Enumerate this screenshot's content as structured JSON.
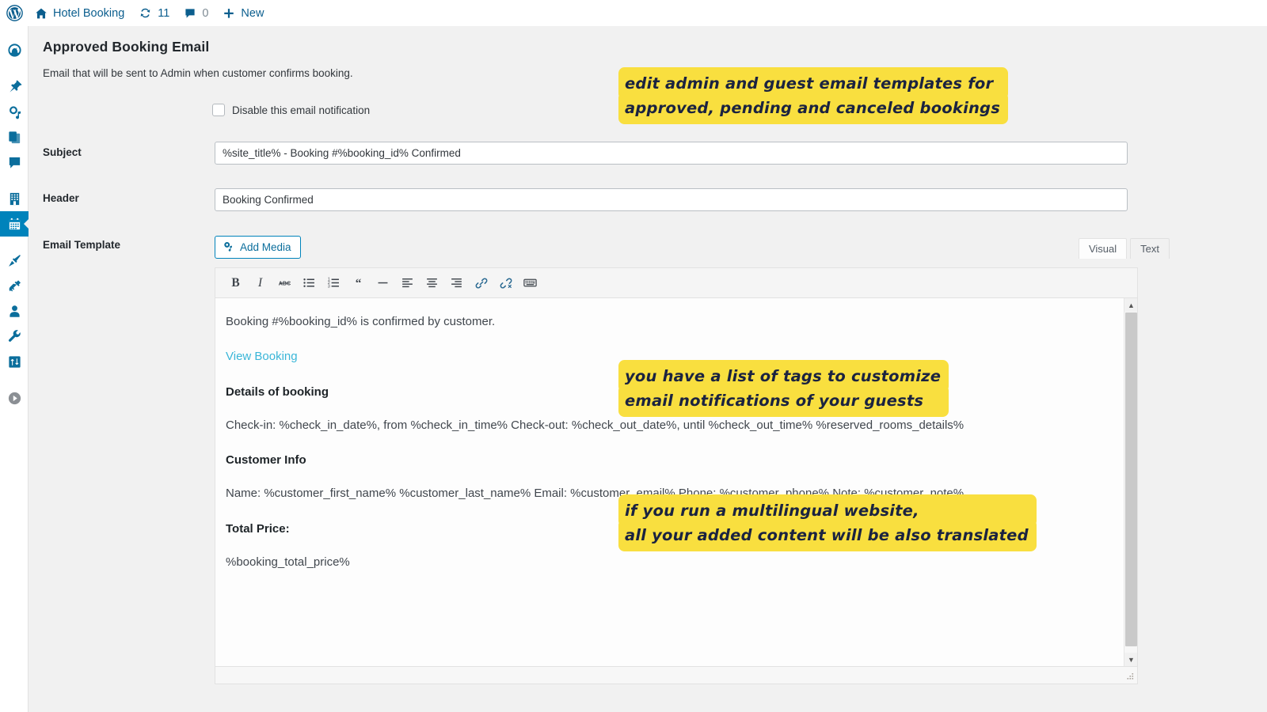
{
  "adminbar": {
    "wp_logo": "wordpress-logo",
    "site_name": "Hotel Booking",
    "updates_count": "11",
    "comments_count": "0",
    "new_label": "New"
  },
  "sidebar": {
    "items": [
      {
        "name": "dashboard",
        "icon": "dashboard-icon",
        "active": false
      },
      {
        "name": "posts",
        "icon": "pin-icon",
        "active": false
      },
      {
        "name": "media",
        "icon": "media-icon",
        "active": false
      },
      {
        "name": "pages",
        "icon": "pages-icon",
        "active": false
      },
      {
        "name": "comments",
        "icon": "comment-icon",
        "active": false
      },
      {
        "name": "accommodation",
        "icon": "building-icon",
        "active": false
      },
      {
        "name": "bookings",
        "icon": "calendar-icon",
        "active": true
      },
      {
        "name": "appearance",
        "icon": "brush-icon",
        "active": false
      },
      {
        "name": "plugins",
        "icon": "plug-icon",
        "active": false
      },
      {
        "name": "users",
        "icon": "user-icon",
        "active": false
      },
      {
        "name": "tools",
        "icon": "wrench-icon",
        "active": false
      },
      {
        "name": "settings",
        "icon": "sliders-icon",
        "active": false
      },
      {
        "name": "collapse-menu",
        "icon": "play-circle-icon",
        "active": false
      }
    ]
  },
  "page": {
    "title": "Approved Booking Email",
    "description": "Email that will be sent to Admin when customer confirms booking."
  },
  "form": {
    "disable_notification_label": "Disable this email notification",
    "disable_notification_checked": false,
    "subject_label": "Subject",
    "subject_value": "%site_title% - Booking #%booking_id% Confirmed",
    "header_label": "Header",
    "header_value": "Booking Confirmed",
    "template_label": "Email Template"
  },
  "editor": {
    "add_media_label": "Add Media",
    "tabs": [
      {
        "label": "Visual",
        "active": true
      },
      {
        "label": "Text",
        "active": false
      }
    ],
    "toolbar": [
      {
        "name": "bold-button",
        "glyph": "B"
      },
      {
        "name": "italic-button",
        "glyph": "I"
      },
      {
        "name": "strikethrough-button",
        "glyph": "ABC"
      },
      {
        "name": "bulleted-list-button",
        "glyph": "list-ul"
      },
      {
        "name": "numbered-list-button",
        "glyph": "list-ol"
      },
      {
        "name": "blockquote-button",
        "glyph": "“"
      },
      {
        "name": "horizontal-rule-button",
        "glyph": "—"
      },
      {
        "name": "align-left-button",
        "glyph": "align-left"
      },
      {
        "name": "align-center-button",
        "glyph": "align-center"
      },
      {
        "name": "align-right-button",
        "glyph": "align-right"
      },
      {
        "name": "insert-link-button",
        "glyph": "link"
      },
      {
        "name": "remove-link-button",
        "glyph": "unlink"
      },
      {
        "name": "toolbar-toggle-button",
        "glyph": "keyboard"
      }
    ],
    "content": {
      "intro": "Booking #%booking_id% is confirmed by customer.",
      "view_booking_link": "View Booking",
      "details_heading": "Details of booking",
      "check_in": "Check-in: %check_in_date%, from %check_in_time%",
      "check_out": "Check-out: %check_out_date%, until %check_out_time%",
      "reserved_rooms": "%reserved_rooms_details%",
      "customer_heading": "Customer Info",
      "customer_name": "Name: %customer_first_name% %customer_last_name%",
      "customer_email": "Email: %customer_email%",
      "customer_phone": "Phone: %customer_phone%",
      "customer_note": "Note: %customer_note%",
      "total_price_heading": "Total Price:",
      "total_price_value": "%booking_total_price%"
    }
  },
  "callouts": [
    {
      "name": "callout-email-templates",
      "line1": "edit admin and guest email templates for",
      "line2": "approved, pending and canceled bookings"
    },
    {
      "name": "callout-tags",
      "line1": "you have a list of tags to customize",
      "line2": "email notifications of your guests"
    },
    {
      "name": "callout-multilingual",
      "line1": "if you run a multilingual website,",
      "line2": "all your added content will be also translated"
    }
  ],
  "colors": {
    "accent_blue": "#0083bb",
    "link_cyan": "#3ab6d8",
    "highlight_yellow": "#f9df3f",
    "page_bg": "#f1f1f1"
  }
}
